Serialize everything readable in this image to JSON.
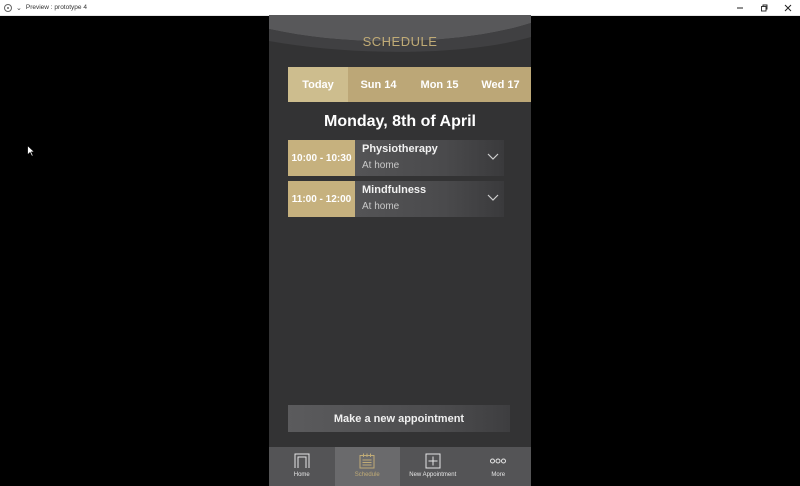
{
  "window": {
    "title": "Preview : prototype 4",
    "controls": [
      "minimize-icon",
      "restore-icon",
      "close-icon"
    ]
  },
  "app": {
    "title": "SCHEDULE",
    "tabs": [
      {
        "label": "Today",
        "active": true
      },
      {
        "label": "Sun 14",
        "active": false
      },
      {
        "label": "Mon 15",
        "active": false
      },
      {
        "label": "Wed 17",
        "active": false
      }
    ],
    "date_heading": "Monday, 8th of April",
    "appointments": [
      {
        "time": "10:00 - 10:30",
        "name": "Physiotherapy",
        "location": "At home"
      },
      {
        "time": "11:00 - 12:00",
        "name": "Mindfulness",
        "location": "At home"
      }
    ],
    "new_appointment_label": "Make a new appointment",
    "nav": [
      {
        "label": "Home",
        "icon": "home-icon",
        "active": false
      },
      {
        "label": "Schedule",
        "icon": "calendar-icon",
        "active": true
      },
      {
        "label": "New Appointment",
        "icon": "plus-square-icon",
        "active": false
      },
      {
        "label": "More",
        "icon": "more-dots-icon",
        "active": false
      }
    ]
  },
  "colors": {
    "accent": "#c0ab76",
    "tab_bar": "#bca777",
    "tab_active": "#cdbd8e",
    "background": "#333334",
    "nav_bar": "#545456"
  }
}
